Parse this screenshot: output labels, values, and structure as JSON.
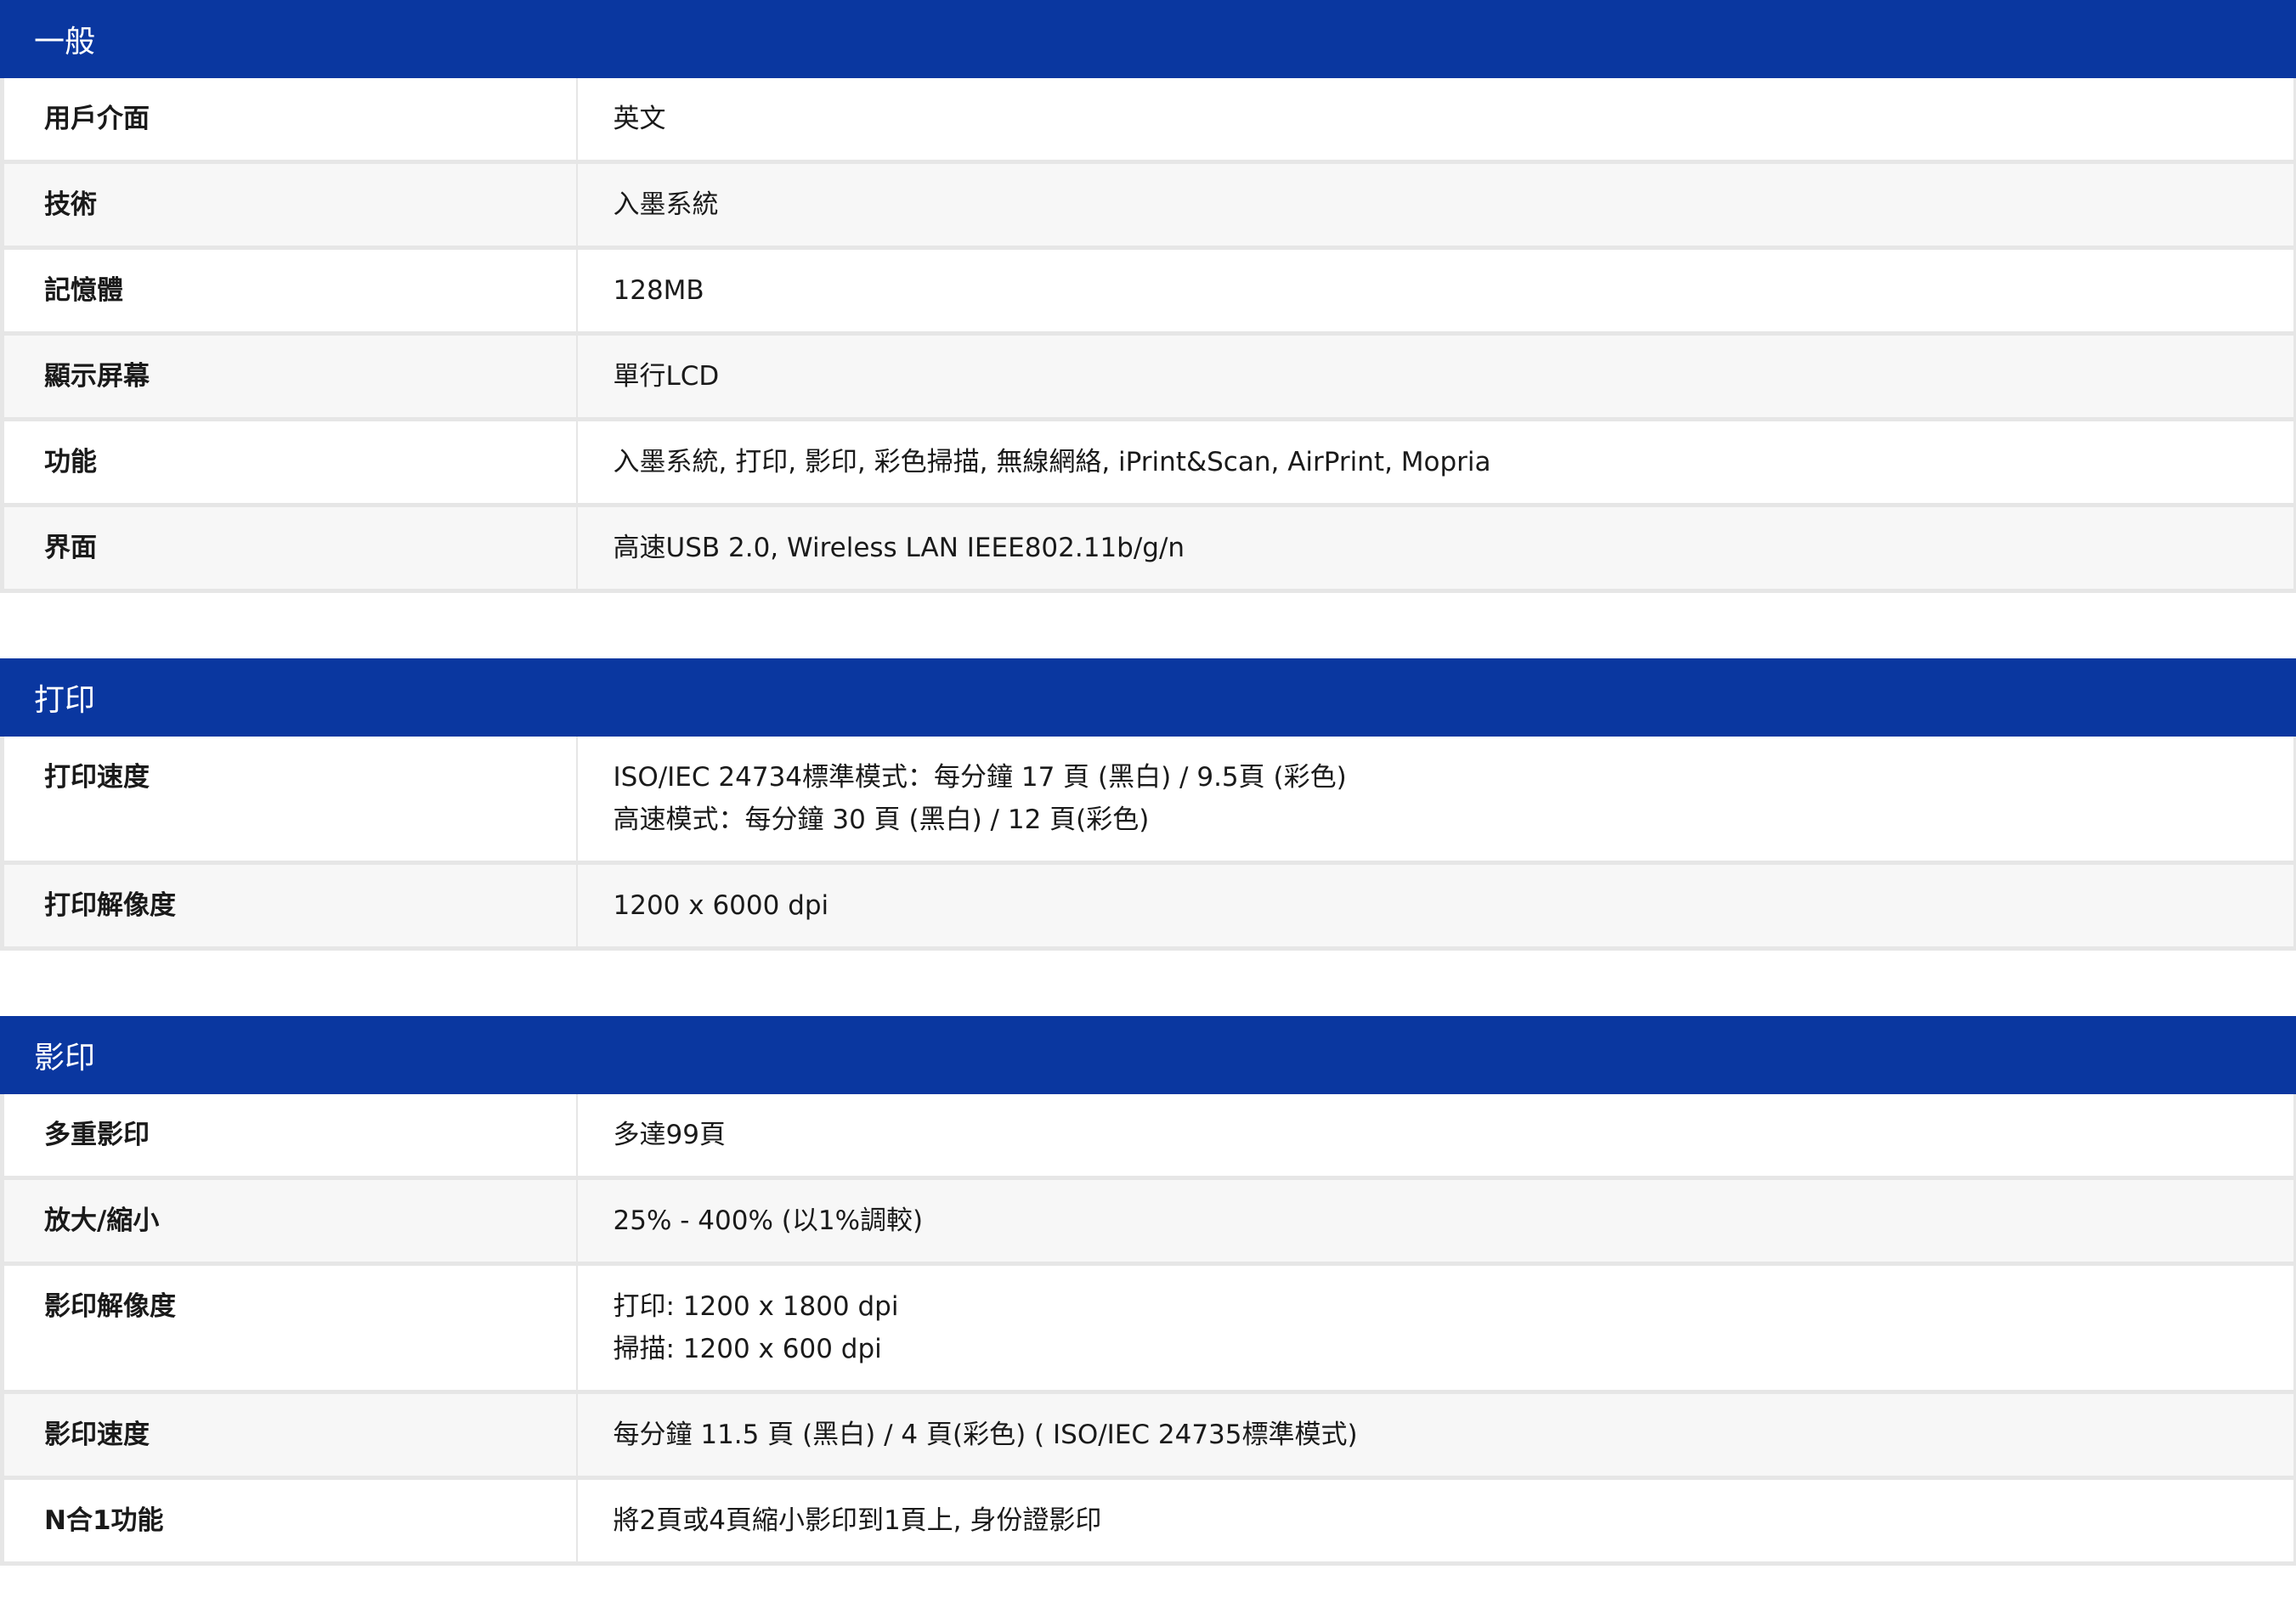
{
  "sections": [
    {
      "title": "一般",
      "rows": [
        {
          "label": "用戶介面",
          "values": [
            "英文"
          ]
        },
        {
          "label": "技術",
          "values": [
            "入墨系統"
          ]
        },
        {
          "label": "記憶體",
          "values": [
            "128MB"
          ]
        },
        {
          "label": "顯示屏幕",
          "values": [
            "單行LCD"
          ]
        },
        {
          "label": "功能",
          "values": [
            "入墨系統, 打印, 影印, 彩色掃描, 無線網絡, iPrint&Scan, AirPrint, Mopria"
          ]
        },
        {
          "label": "界面",
          "values": [
            "高速USB 2.0, Wireless LAN IEEE802.11b/g/n"
          ]
        }
      ]
    },
    {
      "title": "打印",
      "rows": [
        {
          "label": "打印速度",
          "values": [
            "ISO/IEC 24734標準模式：每分鐘 17 頁 (黑白) / 9.5頁 (彩色)",
            "高速模式：每分鐘 30 頁 (黑白) / 12 頁(彩色)"
          ]
        },
        {
          "label": "打印解像度",
          "values": [
            "1200 x 6000 dpi"
          ]
        }
      ]
    },
    {
      "title": "影印",
      "rows": [
        {
          "label": "多重影印",
          "values": [
            "多達99頁"
          ]
        },
        {
          "label": "放大/縮小",
          "values": [
            "25% - 400% (以1%調較)"
          ]
        },
        {
          "label": "影印解像度",
          "values": [
            "打印: 1200 x 1800 dpi",
            "掃描: 1200 x 600 dpi"
          ]
        },
        {
          "label": "影印速度",
          "values": [
            "每分鐘 11.5 頁 (黑白) / 4 頁(彩色) ( ISO/IEC 24735標準模式)"
          ]
        },
        {
          "label": "N合1功能",
          "values": [
            "將2頁或4頁縮小影印到1頁上, 身份證影印"
          ]
        }
      ]
    }
  ]
}
